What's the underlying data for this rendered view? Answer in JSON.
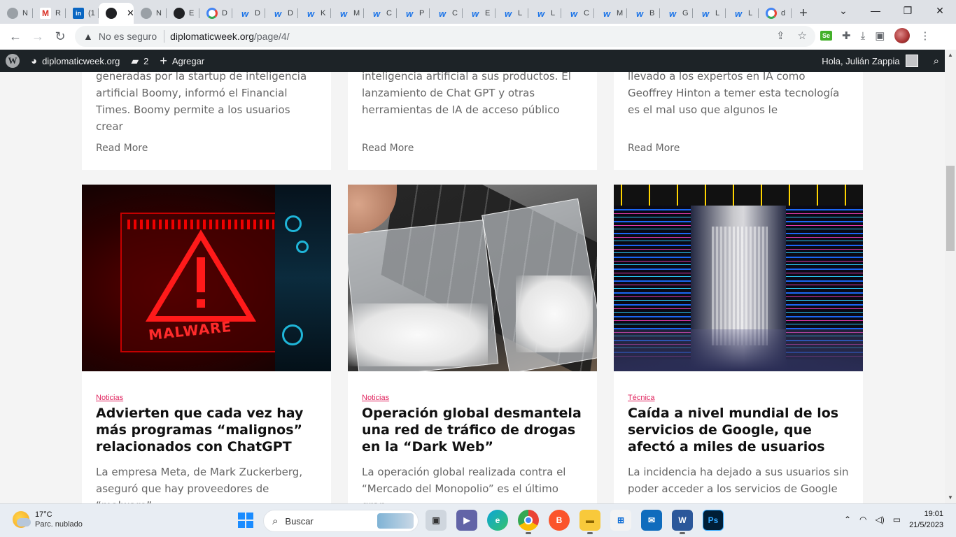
{
  "browser": {
    "tabs": [
      {
        "label": "N",
        "icon": "globe-icon",
        "favclass": "globe",
        "glyph": ""
      },
      {
        "label": "R",
        "icon": "gmail-icon",
        "favclass": "gmail",
        "glyph": "M"
      },
      {
        "label": "(1",
        "icon": "linkedin-icon",
        "favclass": "li",
        "glyph": "in"
      },
      {
        "label": "",
        "icon": "diplomaticweek-icon",
        "favclass": "dark",
        "glyph": "",
        "active": true
      },
      {
        "label": "N",
        "icon": "globe-icon",
        "favclass": "globe",
        "glyph": ""
      },
      {
        "label": "E",
        "icon": "globe-dark-icon",
        "favclass": "dark",
        "glyph": ""
      },
      {
        "label": "D",
        "icon": "google-icon",
        "favclass": "google",
        "glyph": ""
      },
      {
        "label": "D",
        "icon": "w-logo-icon",
        "favclass": "dw",
        "glyph": "w"
      },
      {
        "label": "D",
        "icon": "w-logo-icon",
        "favclass": "dw",
        "glyph": "w"
      },
      {
        "label": "K",
        "icon": "w-logo-icon",
        "favclass": "dw",
        "glyph": "w"
      },
      {
        "label": "M",
        "icon": "w-logo-icon",
        "favclass": "dw",
        "glyph": "w"
      },
      {
        "label": "C",
        "icon": "w-logo-icon",
        "favclass": "dw",
        "glyph": "w"
      },
      {
        "label": "P",
        "icon": "w-logo-icon",
        "favclass": "dw",
        "glyph": "w"
      },
      {
        "label": "C",
        "icon": "w-logo-icon",
        "favclass": "dw",
        "glyph": "w"
      },
      {
        "label": "E",
        "icon": "w-logo-icon",
        "favclass": "dw",
        "glyph": "w"
      },
      {
        "label": "L",
        "icon": "w-logo-icon",
        "favclass": "dw",
        "glyph": "w"
      },
      {
        "label": "L",
        "icon": "w-logo-icon",
        "favclass": "dw",
        "glyph": "w"
      },
      {
        "label": "C",
        "icon": "w-logo-icon",
        "favclass": "dw",
        "glyph": "w"
      },
      {
        "label": "M",
        "icon": "w-logo-icon",
        "favclass": "dw",
        "glyph": "w"
      },
      {
        "label": "B",
        "icon": "w-logo-icon",
        "favclass": "dw",
        "glyph": "w"
      },
      {
        "label": "G",
        "icon": "w-logo-icon",
        "favclass": "dw",
        "glyph": "w"
      },
      {
        "label": "L",
        "icon": "w-logo-icon",
        "favclass": "dw",
        "glyph": "w"
      },
      {
        "label": "L",
        "icon": "w-logo-icon",
        "favclass": "dw",
        "glyph": "w"
      },
      {
        "label": "d",
        "icon": "google-icon",
        "favclass": "google",
        "glyph": ""
      }
    ],
    "security_label": "No es seguro",
    "url_host": "diplomaticweek.org",
    "url_path": "/page/4/"
  },
  "wp_admin": {
    "site_name": "diplomaticweek.org",
    "comments_count": "2",
    "new_label": "Agregar",
    "greeting": "Hola, Julián Zappia"
  },
  "posts_top": [
    {
      "excerpt": "generadas por la startup de inteligencia artificial Boomy, informó el Financial Times. Boomy permite a los usuarios crear",
      "read_more": "Read More"
    },
    {
      "excerpt": "inteligencia artificial a sus productos. El lanzamiento de Chat GPT y otras herramientas de IA de acceso público",
      "read_more": "Read More"
    },
    {
      "excerpt": "llevado a los expertos en IA como Geoffrey Hinton a temer esta tecnología es el mal uso que algunos le",
      "read_more": "Read More"
    }
  ],
  "posts": [
    {
      "category": "Noticias",
      "title": "Advierten que cada vez hay más programas “malignos” relacionados con ChatGPT",
      "excerpt": "La empresa Meta, de Mark Zuckerberg, aseguró que hay proveedores de “malware”",
      "image_text": "MALWARE"
    },
    {
      "category": "Noticias",
      "title": "Operación global desmantela una red de tráfico de drogas en la “Dark Web”",
      "excerpt": "La operación global realizada contra el “Mercado del Monopolio” es el último gran"
    },
    {
      "category": "Técnica",
      "title": "Caída a nivel mundial de los servicios de Google, que afectó a miles de usuarios",
      "excerpt": "La incidencia ha dejado a sus usuarios sin poder acceder a los servicios de Google"
    }
  ],
  "taskbar": {
    "temp": "17°C",
    "weather": "Parc. nublado",
    "search_label": "Buscar",
    "time": "19:01",
    "date": "21/5/2023"
  },
  "colors": {
    "category": "#e0245e",
    "wp_bar": "#1d2327",
    "taskbar": "#e8edf3"
  }
}
